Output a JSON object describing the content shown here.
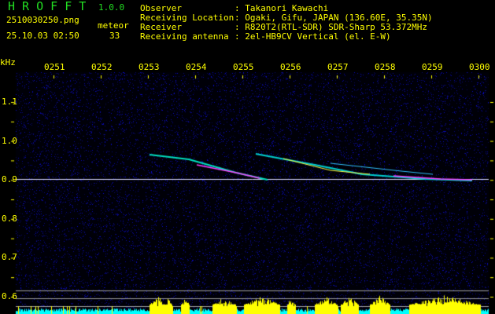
{
  "app": {
    "name": "H R O F F T",
    "version": "1.0.0"
  },
  "file": {
    "name": "2510030250.png",
    "datetime": "25.10.03 02:50"
  },
  "meteor": {
    "label": "meteor",
    "count": "33"
  },
  "info": [
    {
      "label": "Observer",
      "value": ": Takanori Kawachi"
    },
    {
      "label": "Receiving Location",
      "value": ": Ogaki, Gifu, JAPAN (136.60E, 35.35N)"
    },
    {
      "label": "Receiver",
      "value": ": R820T2(RTL-SDR) SDR-Sharp 53.372MHz"
    },
    {
      "label": "Receiving antenna",
      "value": ": 2el-HB9CV Vertical (el. E-W)"
    }
  ],
  "axis": {
    "unit": "kHz",
    "time_ticks": [
      "0251",
      "0252",
      "0253",
      "0254",
      "0255",
      "0256",
      "0257",
      "0258",
      "0259",
      "0300"
    ],
    "freq_ticks": [
      "1.1",
      "1.0",
      "0.9",
      "0.8",
      "0.7",
      "0.6"
    ]
  },
  "colors": {
    "text": "#ffff00",
    "logo": "#22dd22",
    "noise": "#1a1aa0",
    "bar_hi": "#ffff00",
    "bar_lo": "#00ffff"
  }
}
